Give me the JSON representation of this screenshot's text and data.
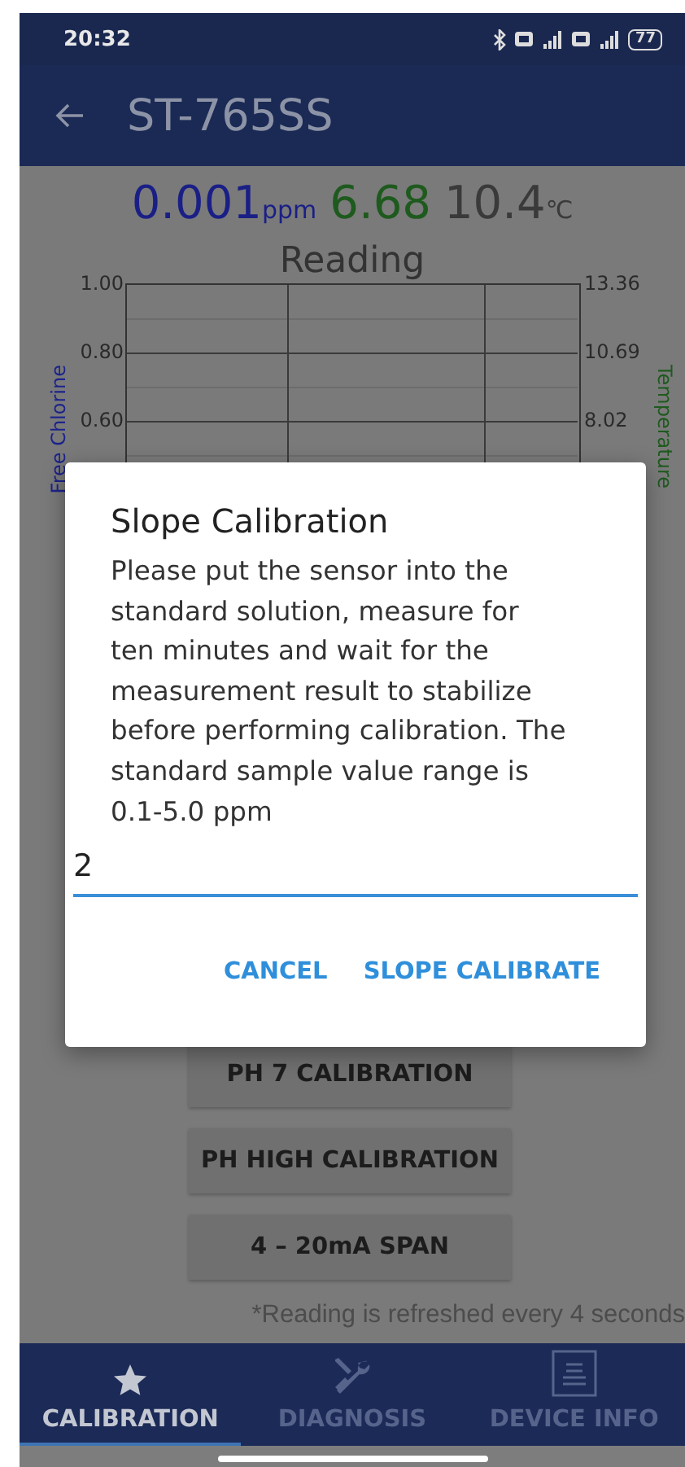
{
  "status_bar": {
    "time": "20:32",
    "battery": "77"
  },
  "app_bar": {
    "title": "ST-765SS"
  },
  "readings": [
    {
      "kind": "chlorine",
      "value": "0.001",
      "unit": "ppm"
    },
    {
      "kind": "ph",
      "value": "6.68"
    },
    {
      "kind": "temperature",
      "value": "10.4",
      "unit": "℃"
    }
  ],
  "chart": {
    "title": "Reading",
    "left_axis_label": "Free Chlorine",
    "right_axis_label": "Temperature",
    "left_ticks": [
      "1.00",
      "0.80",
      "0.60"
    ],
    "right_ticks": [
      "13.36",
      "10.69",
      "8.02"
    ]
  },
  "buttons": [
    "PH 7 CALIBRATION",
    "PH HIGH CALIBRATION",
    "4 – 20mA SPAN"
  ],
  "footnote": "*Reading is refreshed every 4 seconds",
  "bottom_nav": [
    {
      "label": "CALIBRATION",
      "selected": true
    },
    {
      "label": "DIAGNOSIS",
      "selected": false
    },
    {
      "label": "DEVICE INFO",
      "selected": false
    }
  ],
  "dialog": {
    "title": "Slope Calibration",
    "message": "Please put the sensor into the standard solution, measure for ten minutes and wait for the measurement result to stabilize before performing calibration. The standard sample value range is 0.1-5.0  ppm",
    "input_value": "2",
    "buttons": [
      "CANCEL",
      "SLOPE CALIBRATE"
    ]
  }
}
